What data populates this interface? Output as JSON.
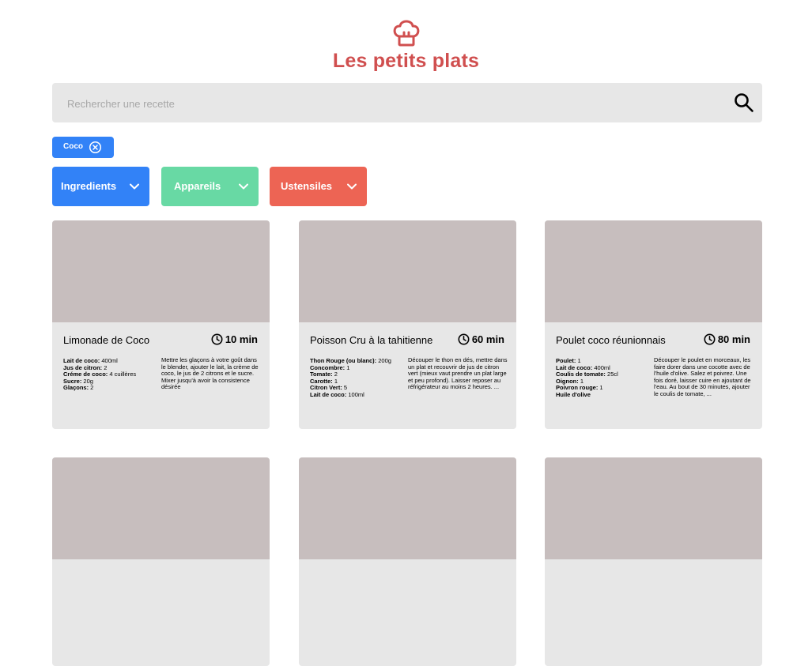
{
  "header": {
    "logo_icon": "chef-hat-icon",
    "title": "Les petits plats"
  },
  "search": {
    "placeholder": "Rechercher une recette",
    "value": "",
    "icon": "search-icon"
  },
  "tags": [
    {
      "label": "Coco",
      "close_icon": "close-circle-icon",
      "color": "#3282f7"
    }
  ],
  "filters": [
    {
      "label": "Ingredients",
      "color": "#3282f7",
      "icon": "chevron-down-icon"
    },
    {
      "label": "Appareils",
      "color": "#68d9a4",
      "icon": "chevron-down-icon"
    },
    {
      "label": "Ustensiles",
      "color": "#ed6454",
      "icon": "chevron-down-icon"
    }
  ],
  "colors": {
    "title": "#d04f4f",
    "card_bg": "#e7e7e7",
    "card_image": "#c7bebe",
    "search_bg": "#e7e7e7"
  },
  "recipes": [
    {
      "name": "Limonade de Coco",
      "time": "10 min",
      "ingredients": [
        {
          "name": "Lait de coco:",
          "qty": " 400ml"
        },
        {
          "name": "Jus de citron:",
          "qty": " 2"
        },
        {
          "name": "Créme de coco:",
          "qty": " 4 cuillères"
        },
        {
          "name": "Sucre:",
          "qty": " 20g"
        },
        {
          "name": "Glaçons:",
          "qty": " 2"
        }
      ],
      "description": "Mettre les glaçons à votre goût dans le blender, ajouter le lait, la crème de coco, le jus de 2 citrons et le sucre. Mixer jusqu'à avoir la consistence désirée"
    },
    {
      "name": "Poisson Cru à la tahitienne",
      "time": "60 min",
      "ingredients": [
        {
          "name": "Thon Rouge (ou blanc):",
          "qty": " 200g"
        },
        {
          "name": "Concombre:",
          "qty": " 1"
        },
        {
          "name": "Tomate:",
          "qty": " 2"
        },
        {
          "name": "Carotte:",
          "qty": " 1"
        },
        {
          "name": "Citron Vert:",
          "qty": " 5"
        },
        {
          "name": "Lait de coco:",
          "qty": " 100ml"
        }
      ],
      "description": "Découper le thon en dés, mettre dans un plat et recouvrir de jus de citron vert (mieux vaut prendre un plat large et peu profond). Laisser reposer au réfrigérateur au moins 2 heures. ..."
    },
    {
      "name": "Poulet coco réunionnais",
      "time": "80 min",
      "ingredients": [
        {
          "name": "Poulet:",
          "qty": " 1"
        },
        {
          "name": "Lait de coco:",
          "qty": " 400ml"
        },
        {
          "name": "Coulis de tomate:",
          "qty": " 25cl"
        },
        {
          "name": "Oignon:",
          "qty": " 1"
        },
        {
          "name": "Poivron rouge:",
          "qty": " 1"
        },
        {
          "name": "Huile d'olive",
          "qty": ""
        }
      ],
      "description": "Découper le poulet en morceaux, les faire dorer dans une cocotte avec de l'huile d'olive. Salez et poivrez. Une fois doré, laisser cuire en ajoutant de l'eau. Au bout de 30 minutes, ajouter le coulis de tomate, ..."
    },
    {
      "name": "",
      "time": "",
      "ingredients": [],
      "description": ""
    },
    {
      "name": "",
      "time": "",
      "ingredients": [],
      "description": ""
    },
    {
      "name": "",
      "time": "",
      "ingredients": [],
      "description": ""
    }
  ]
}
